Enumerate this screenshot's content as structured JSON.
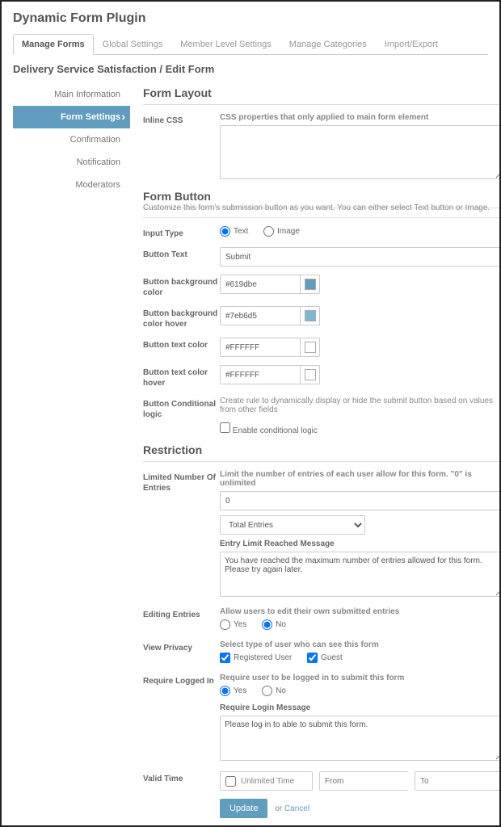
{
  "page_title": "Dynamic Form Plugin",
  "tabs": [
    "Manage Forms",
    "Global Settings",
    "Member Level Settings",
    "Manage Categories",
    "Import/Export"
  ],
  "active_tab": 0,
  "breadcrumb": "Delivery Service Satisfaction / Edit Form",
  "sidebar": {
    "items": [
      "Main Information",
      "Form Settings",
      "Confirmation",
      "Notification",
      "Moderators"
    ],
    "active": 1
  },
  "sections": {
    "form_layout": {
      "title": "Form Layout",
      "inline_css": {
        "label": "Inline CSS",
        "hint": "CSS properties that only applied to main form element",
        "value": ""
      }
    },
    "form_button": {
      "title": "Form Button",
      "subtitle": "Customize this form's submission button as you want. You can either select Text button or Image.",
      "input_type": {
        "label": "Input Type",
        "options": [
          "Text",
          "Image"
        ],
        "selected": "Text"
      },
      "button_text": {
        "label": "Button Text",
        "value": "Submit"
      },
      "bg_color": {
        "label": "Button background color",
        "value": "#619dbe",
        "swatch": "#619dbe"
      },
      "bg_hover": {
        "label": "Button background color hover",
        "value": "#7eb6d5",
        "swatch": "#7eb6d5"
      },
      "text_color": {
        "label": "Button text color",
        "value": "#FFFFFF",
        "swatch": "#FFFFFF"
      },
      "text_hover": {
        "label": "Button text color hover",
        "value": "#FFFFFF",
        "swatch": "#FFFFFF"
      },
      "conditional": {
        "label": "Button Conditional logic",
        "hint": "Create rule to dynamically display or hide the submit button based on values from other fields",
        "checkbox_label": "Enable conditional logic",
        "checked": false
      }
    },
    "restriction": {
      "title": "Restriction",
      "limit": {
        "label": "Limited Number Of Entries",
        "hint": "Limit the number of entries of each user allow for this form. \"0\" is unlimited",
        "value": "0",
        "select_value": "Total Entries",
        "msg_label": "Entry Limit Reached Message",
        "msg_value": "You have reached the maximum number of entries allowed for this form. Please try again later."
      },
      "editing": {
        "label": "Editing Entries",
        "hint": "Allow users to edit their own submitted entries",
        "options": [
          "Yes",
          "No"
        ],
        "selected": "No"
      },
      "privacy": {
        "label": "View Privacy",
        "hint": "Select type of user who can see this form",
        "options": [
          "Registered User",
          "Guest"
        ],
        "checked": [
          "Registered User",
          "Guest"
        ]
      },
      "require_login": {
        "label": "Require Logged In",
        "hint": "Require user to be logged in to submit this form",
        "options": [
          "Yes",
          "No"
        ],
        "selected": "Yes",
        "msg_label": "Require Login Message",
        "msg_value": "Please log in to able to submit this form."
      },
      "valid_time": {
        "label": "Valid Time",
        "unlimited_label": "Unlimited Time",
        "unlimited_checked": false,
        "from_placeholder": "From",
        "to_placeholder": "To"
      }
    }
  },
  "actions": {
    "update": "Update",
    "or": "or",
    "cancel": "Cancel"
  },
  "colors": {
    "accent": "#619dbe"
  }
}
